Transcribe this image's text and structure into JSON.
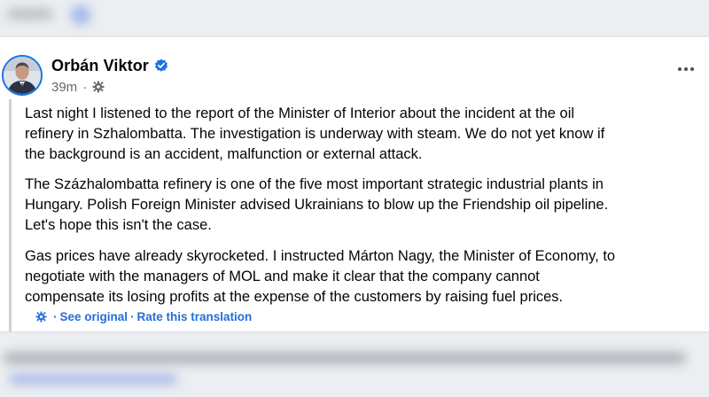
{
  "post": {
    "author": "Orbán Viktor",
    "time": "39m",
    "paragraphs": [
      "Last night I listened to the report of the Minister of Interior about the incident at the oil\nrefinery in Szhalombatta. The investigation is underway with steam. We do not yet know if\nthe background is an accident, malfunction or external attack.",
      "The Százhalombatta refinery is one of the five most important strategic industrial plants in\nHungary. Polish Foreign Minister advised Ukrainians to blow up the Friendship oil pipeline.\nLet's hope this isn't the case.",
      "Gas prices have already skyrocketed. I instructed Márton Nagy, the Minister of Economy, to\nnegotiate with the managers of MOL and make it clear that the company cannot\ncompensate its losing profits at the expense of the customers by raising fuel prices."
    ],
    "translation": {
      "see_original": "See original",
      "separator": "·",
      "rate": "Rate this translation"
    }
  },
  "icons": {
    "verified": "verified-badge-icon",
    "audience": "gear-icon",
    "more": "more-options-icon",
    "translation": "gear-icon"
  },
  "colors": {
    "link_blue": "#216fdb",
    "verified_blue": "#1b74e4",
    "secondary_text": "#65676b"
  }
}
